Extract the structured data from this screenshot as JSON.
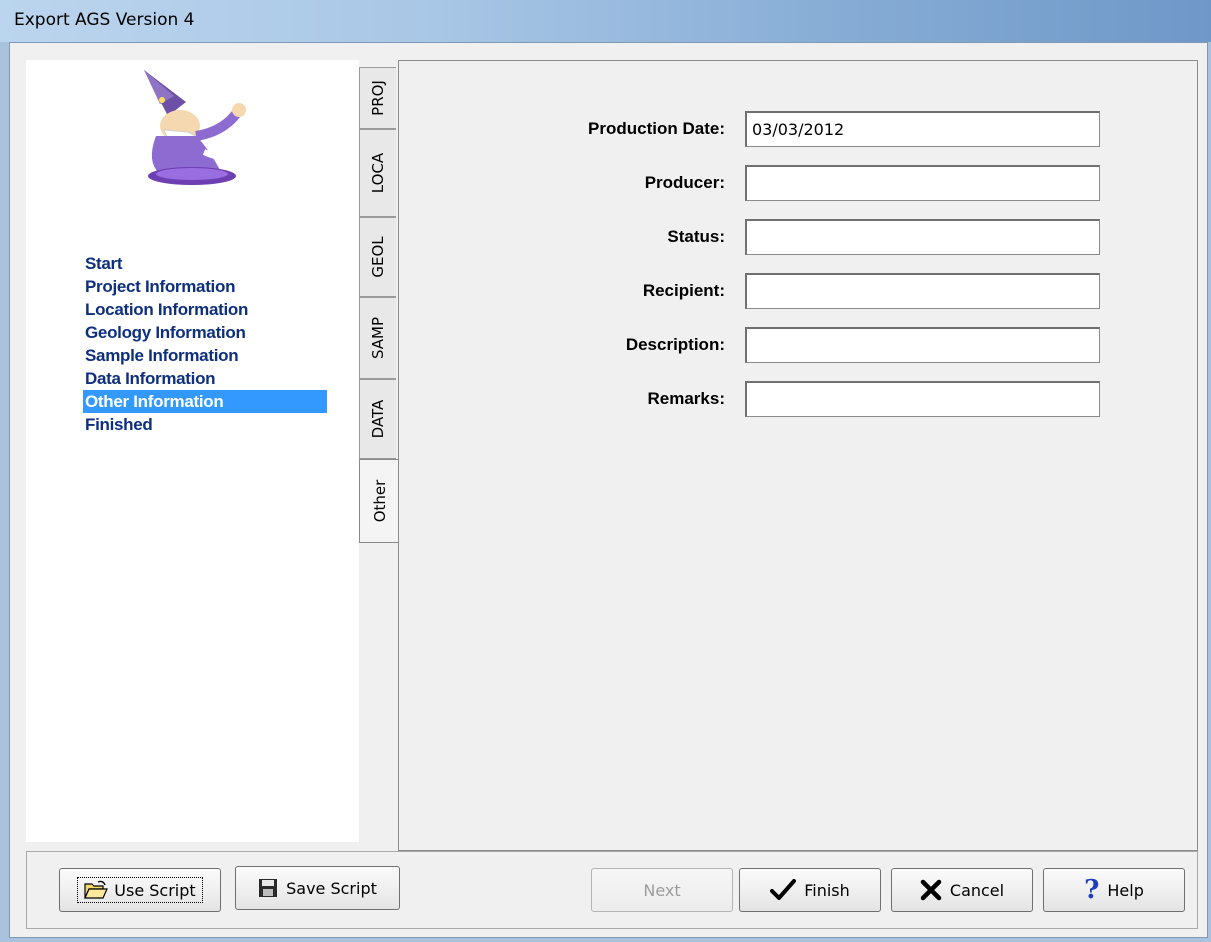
{
  "window": {
    "title": "Export AGS Version 4"
  },
  "steps": [
    {
      "label": "Start",
      "active": false
    },
    {
      "label": "Project Information",
      "active": false
    },
    {
      "label": "Location Information",
      "active": false
    },
    {
      "label": "Geology Information",
      "active": false
    },
    {
      "label": "Sample Information",
      "active": false
    },
    {
      "label": "Data Information",
      "active": false
    },
    {
      "label": "Other Information",
      "active": true
    },
    {
      "label": "Finished",
      "active": false
    }
  ],
  "tabs": [
    {
      "label": "PROJ"
    },
    {
      "label": "LOCA"
    },
    {
      "label": "GEOL"
    },
    {
      "label": "SAMP"
    },
    {
      "label": "DATA"
    },
    {
      "label": "Other",
      "selected": true
    }
  ],
  "form": {
    "fields": [
      {
        "label": "Production Date:",
        "value": "03/03/2012"
      },
      {
        "label": "Producer:",
        "value": ""
      },
      {
        "label": "Status:",
        "value": ""
      },
      {
        "label": "Recipient:",
        "value": ""
      },
      {
        "label": "Description:",
        "value": ""
      },
      {
        "label": "Remarks:",
        "value": ""
      }
    ]
  },
  "buttons": {
    "use_script": "Use Script",
    "save_script": "Save Script",
    "next": "Next",
    "finish": "Finish",
    "cancel": "Cancel",
    "help": "Help"
  },
  "icons": {
    "use_script": "folder-open-icon",
    "save_script": "floppy-disk-icon",
    "finish": "checkmark-icon",
    "cancel": "x-icon",
    "help": "question-mark-icon"
  },
  "colors": {
    "selected_step_bg": "#3399ff",
    "step_text": "#0d2f7d"
  }
}
